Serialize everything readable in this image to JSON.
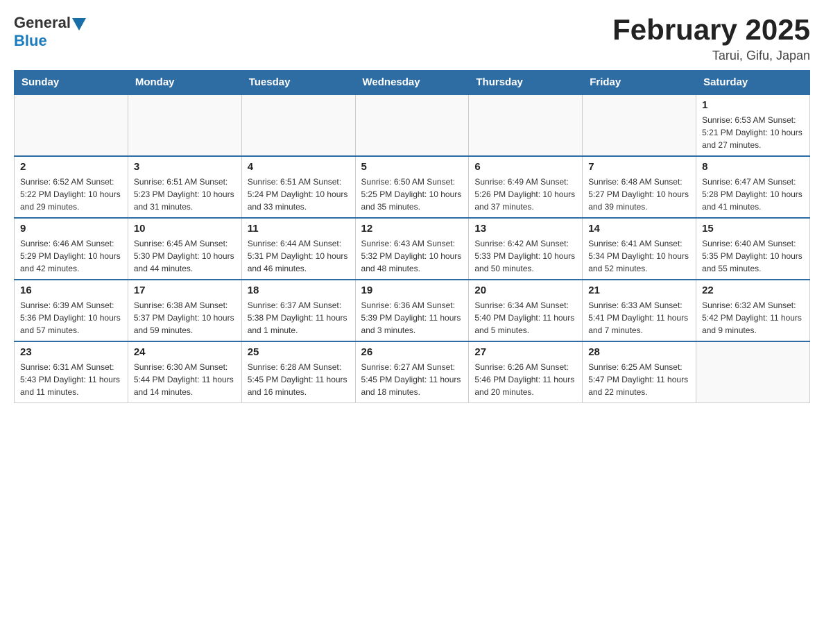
{
  "header": {
    "logo_general": "General",
    "logo_blue": "Blue",
    "month_title": "February 2025",
    "location": "Tarui, Gifu, Japan"
  },
  "days_of_week": [
    "Sunday",
    "Monday",
    "Tuesday",
    "Wednesday",
    "Thursday",
    "Friday",
    "Saturday"
  ],
  "weeks": [
    {
      "days": [
        {
          "number": "",
          "info": ""
        },
        {
          "number": "",
          "info": ""
        },
        {
          "number": "",
          "info": ""
        },
        {
          "number": "",
          "info": ""
        },
        {
          "number": "",
          "info": ""
        },
        {
          "number": "",
          "info": ""
        },
        {
          "number": "1",
          "info": "Sunrise: 6:53 AM\nSunset: 5:21 PM\nDaylight: 10 hours\nand 27 minutes."
        }
      ]
    },
    {
      "days": [
        {
          "number": "2",
          "info": "Sunrise: 6:52 AM\nSunset: 5:22 PM\nDaylight: 10 hours\nand 29 minutes."
        },
        {
          "number": "3",
          "info": "Sunrise: 6:51 AM\nSunset: 5:23 PM\nDaylight: 10 hours\nand 31 minutes."
        },
        {
          "number": "4",
          "info": "Sunrise: 6:51 AM\nSunset: 5:24 PM\nDaylight: 10 hours\nand 33 minutes."
        },
        {
          "number": "5",
          "info": "Sunrise: 6:50 AM\nSunset: 5:25 PM\nDaylight: 10 hours\nand 35 minutes."
        },
        {
          "number": "6",
          "info": "Sunrise: 6:49 AM\nSunset: 5:26 PM\nDaylight: 10 hours\nand 37 minutes."
        },
        {
          "number": "7",
          "info": "Sunrise: 6:48 AM\nSunset: 5:27 PM\nDaylight: 10 hours\nand 39 minutes."
        },
        {
          "number": "8",
          "info": "Sunrise: 6:47 AM\nSunset: 5:28 PM\nDaylight: 10 hours\nand 41 minutes."
        }
      ]
    },
    {
      "days": [
        {
          "number": "9",
          "info": "Sunrise: 6:46 AM\nSunset: 5:29 PM\nDaylight: 10 hours\nand 42 minutes."
        },
        {
          "number": "10",
          "info": "Sunrise: 6:45 AM\nSunset: 5:30 PM\nDaylight: 10 hours\nand 44 minutes."
        },
        {
          "number": "11",
          "info": "Sunrise: 6:44 AM\nSunset: 5:31 PM\nDaylight: 10 hours\nand 46 minutes."
        },
        {
          "number": "12",
          "info": "Sunrise: 6:43 AM\nSunset: 5:32 PM\nDaylight: 10 hours\nand 48 minutes."
        },
        {
          "number": "13",
          "info": "Sunrise: 6:42 AM\nSunset: 5:33 PM\nDaylight: 10 hours\nand 50 minutes."
        },
        {
          "number": "14",
          "info": "Sunrise: 6:41 AM\nSunset: 5:34 PM\nDaylight: 10 hours\nand 52 minutes."
        },
        {
          "number": "15",
          "info": "Sunrise: 6:40 AM\nSunset: 5:35 PM\nDaylight: 10 hours\nand 55 minutes."
        }
      ]
    },
    {
      "days": [
        {
          "number": "16",
          "info": "Sunrise: 6:39 AM\nSunset: 5:36 PM\nDaylight: 10 hours\nand 57 minutes."
        },
        {
          "number": "17",
          "info": "Sunrise: 6:38 AM\nSunset: 5:37 PM\nDaylight: 10 hours\nand 59 minutes."
        },
        {
          "number": "18",
          "info": "Sunrise: 6:37 AM\nSunset: 5:38 PM\nDaylight: 11 hours\nand 1 minute."
        },
        {
          "number": "19",
          "info": "Sunrise: 6:36 AM\nSunset: 5:39 PM\nDaylight: 11 hours\nand 3 minutes."
        },
        {
          "number": "20",
          "info": "Sunrise: 6:34 AM\nSunset: 5:40 PM\nDaylight: 11 hours\nand 5 minutes."
        },
        {
          "number": "21",
          "info": "Sunrise: 6:33 AM\nSunset: 5:41 PM\nDaylight: 11 hours\nand 7 minutes."
        },
        {
          "number": "22",
          "info": "Sunrise: 6:32 AM\nSunset: 5:42 PM\nDaylight: 11 hours\nand 9 minutes."
        }
      ]
    },
    {
      "days": [
        {
          "number": "23",
          "info": "Sunrise: 6:31 AM\nSunset: 5:43 PM\nDaylight: 11 hours\nand 11 minutes."
        },
        {
          "number": "24",
          "info": "Sunrise: 6:30 AM\nSunset: 5:44 PM\nDaylight: 11 hours\nand 14 minutes."
        },
        {
          "number": "25",
          "info": "Sunrise: 6:28 AM\nSunset: 5:45 PM\nDaylight: 11 hours\nand 16 minutes."
        },
        {
          "number": "26",
          "info": "Sunrise: 6:27 AM\nSunset: 5:45 PM\nDaylight: 11 hours\nand 18 minutes."
        },
        {
          "number": "27",
          "info": "Sunrise: 6:26 AM\nSunset: 5:46 PM\nDaylight: 11 hours\nand 20 minutes."
        },
        {
          "number": "28",
          "info": "Sunrise: 6:25 AM\nSunset: 5:47 PM\nDaylight: 11 hours\nand 22 minutes."
        },
        {
          "number": "",
          "info": ""
        }
      ]
    }
  ]
}
